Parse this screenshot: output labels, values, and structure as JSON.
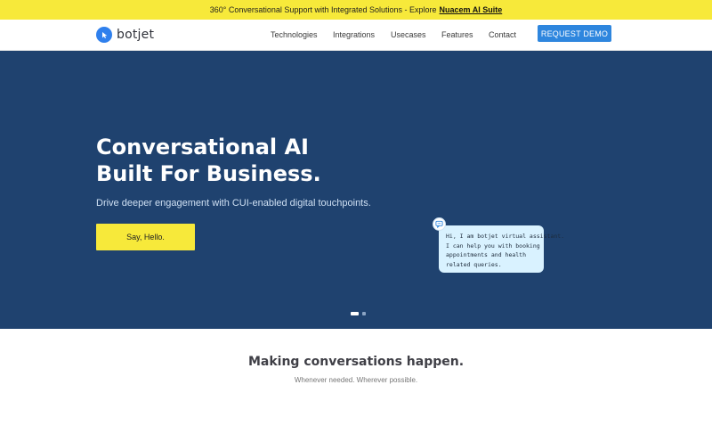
{
  "announcement": {
    "text": "360° Conversational Support with Integrated Solutions - Explore",
    "link_label": "Nuacem AI Suite"
  },
  "header": {
    "logo_text": "botjet",
    "logo_icon": "cursor-bubble-icon",
    "nav_items": [
      {
        "label": "Technologies"
      },
      {
        "label": "Integrations"
      },
      {
        "label": "Usecases"
      },
      {
        "label": "Features"
      },
      {
        "label": "Contact"
      }
    ],
    "cta_label": "REQUEST DEMO"
  },
  "hero": {
    "title_line1": "Conversational AI",
    "title_line2": "Built For Business.",
    "subtitle": "Drive deeper engagement with CUI-enabled digital touchpoints.",
    "cta_label": "Say, Hello.",
    "chat": {
      "icon": "chat-bubble-icon",
      "lines": [
        "Hi, I am botjet virtual assistant.",
        "I can help you with booking",
        "appointments and health",
        "related queries."
      ]
    },
    "carousel": {
      "slide_count": 2,
      "active_index": 0
    }
  },
  "section": {
    "title": "Making conversations happen.",
    "subtitle": "Whenever needed. Wherever possible."
  },
  "colors": {
    "announcement_bg": "#f7e93a",
    "hero_bg": "#1f426f",
    "accent_blue": "#2e86de",
    "cta_yellow": "#f7e93a",
    "chat_bg": "#d9f2ff"
  }
}
